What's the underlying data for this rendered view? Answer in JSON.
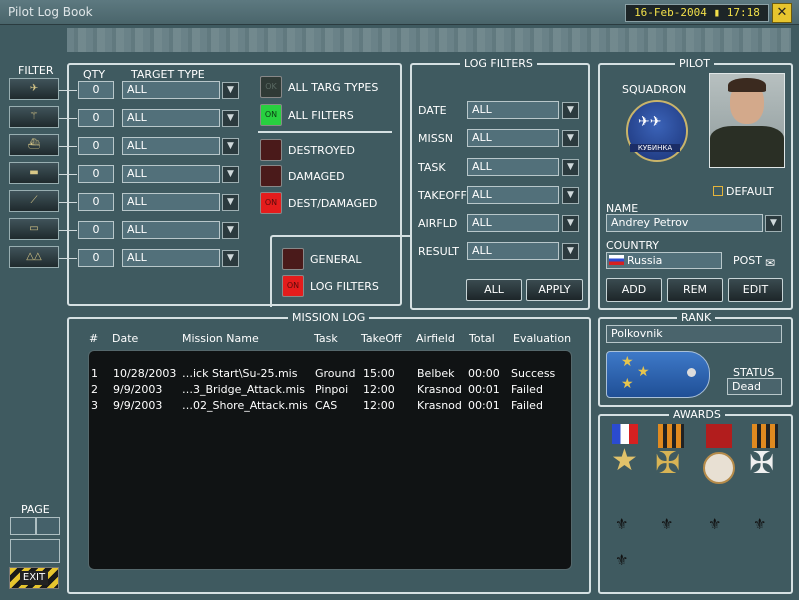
{
  "window": {
    "title": "Pilot Log Book",
    "date": "16-Feb-2004",
    "time": "17:18",
    "close_label": "✕"
  },
  "filter": {
    "title": "FILTER",
    "qty_header": "QTY",
    "target_type_header": "TARGET TYPE",
    "rows": [
      {
        "icon": "aircraft-icon",
        "qty": "0",
        "type": "ALL"
      },
      {
        "icon": "helicopter-icon",
        "qty": "0",
        "type": "ALL"
      },
      {
        "icon": "ship-icon",
        "qty": "0",
        "type": "ALL"
      },
      {
        "icon": "tank-icon",
        "qty": "0",
        "type": "ALL"
      },
      {
        "icon": "artillery-icon",
        "qty": "0",
        "type": "ALL"
      },
      {
        "icon": "vehicle-icon",
        "qty": "0",
        "type": "ALL"
      },
      {
        "icon": "structure-icon",
        "qty": "0",
        "type": "ALL"
      }
    ],
    "indicators": [
      {
        "label": "ALL TARG TYPES",
        "state": "OK",
        "color": "green-off"
      },
      {
        "label": "ALL FILTERS",
        "state": "ON",
        "color": "green-on"
      },
      {
        "label": "DESTROYED",
        "state": "",
        "color": "red-off"
      },
      {
        "label": "DAMAGED",
        "state": "",
        "color": "red-off"
      },
      {
        "label": "DEST/DAMAGED",
        "state": "ON",
        "color": "red-on"
      }
    ],
    "mode": [
      {
        "label": "GENERAL",
        "state": "",
        "color": "red-off"
      },
      {
        "label": "LOG FILTERS",
        "state": "ON",
        "color": "red-on"
      }
    ]
  },
  "log_filters": {
    "title": "LOG FILTERS",
    "fields": [
      {
        "label": "DATE",
        "value": "ALL"
      },
      {
        "label": "MISSN",
        "value": "ALL"
      },
      {
        "label": "TASK",
        "value": "ALL"
      },
      {
        "label": "TAKEOFF",
        "value": "ALL"
      },
      {
        "label": "AIRFLD",
        "value": "ALL"
      },
      {
        "label": "RESULT",
        "value": "ALL"
      }
    ],
    "all_button": "ALL",
    "apply_button": "APPLY"
  },
  "pilot": {
    "title": "PILOT",
    "squadron_label": "SQUADRON",
    "squadron_badge_text": "КУБИНКА",
    "default_label": "DEFAULT",
    "name_label": "NAME",
    "name_value": "Andrey Petrov",
    "country_label": "COUNTRY",
    "country_value": "Russia",
    "post_label": "POST",
    "add_button": "ADD",
    "rem_button": "REM",
    "edit_button": "EDIT"
  },
  "rank": {
    "title": "RANK",
    "value": "Polkovnik",
    "status_label": "STATUS",
    "status_value": "Dead"
  },
  "awards": {
    "title": "AWARDS"
  },
  "mission_log": {
    "title": "MISSION LOG",
    "headers": [
      "#",
      "Date",
      "Mission Name",
      "Task",
      "TakeOff",
      "Airfield",
      "Total",
      "Evaluation"
    ],
    "rows": [
      [
        "1",
        "10/28/2003",
        "…ick Start\\Su-25.mis",
        "Ground",
        "15:00",
        "Belbek",
        "00:00",
        "Success"
      ],
      [
        "2",
        "9/9/2003",
        "…3_Bridge_Attack.mis",
        "Pinpoi",
        "12:00",
        "Krasnod",
        "00:01",
        "Failed"
      ],
      [
        "3",
        "9/9/2003",
        "…02_Shore_Attack.mis",
        "CAS",
        "12:00",
        "Krasnod",
        "00:01",
        "Failed"
      ]
    ]
  },
  "page": {
    "label": "PAGE",
    "exit_button": "EXIT"
  }
}
